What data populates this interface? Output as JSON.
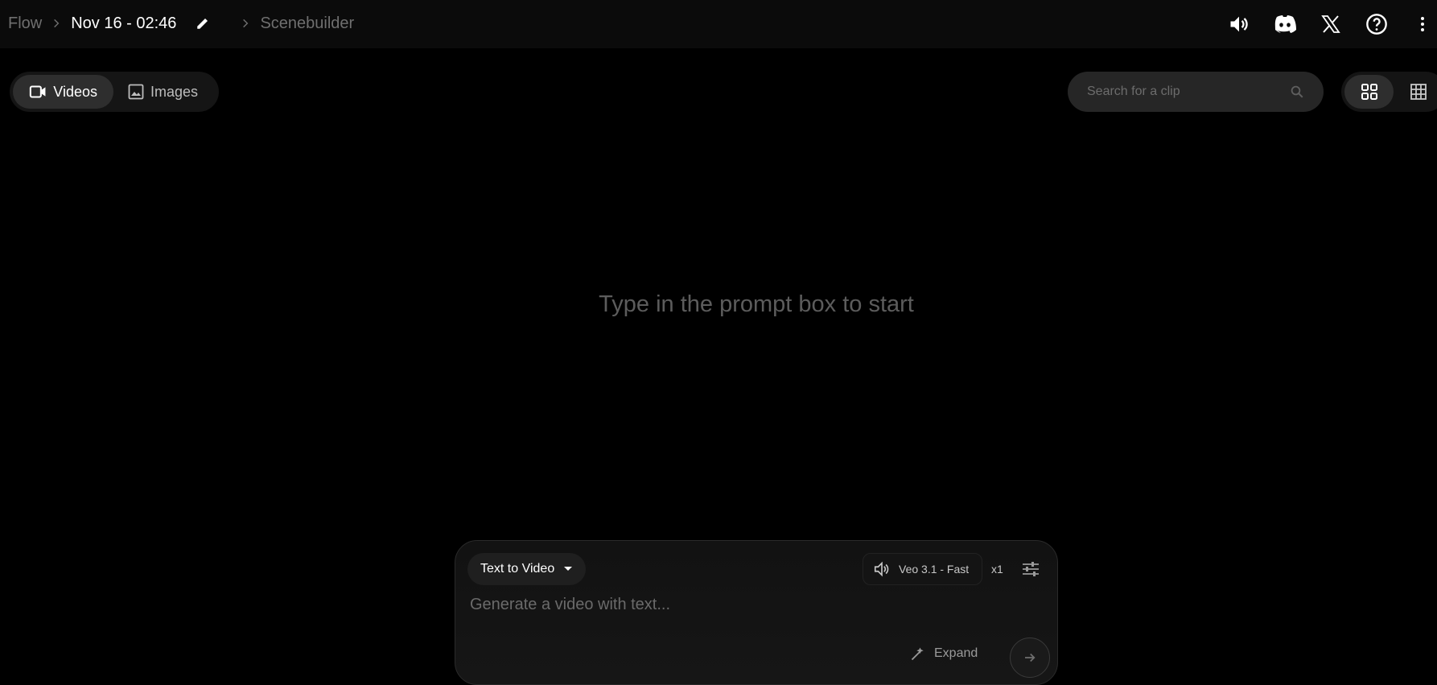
{
  "breadcrumb": {
    "root": "Flow",
    "project_title": "Nov 16 - 02:46",
    "section": "Scenebuilder"
  },
  "top_icons": [
    "volume-icon",
    "discord-icon",
    "x-icon",
    "help-icon",
    "more-vert-icon"
  ],
  "media_tabs": {
    "videos": "Videos",
    "images": "Images",
    "active": "videos"
  },
  "search": {
    "placeholder": "Search for a clip"
  },
  "view_toggle": {
    "active": "grid-large"
  },
  "main": {
    "empty_message": "Type in the prompt box to start"
  },
  "prompt_box": {
    "mode_label": "Text to Video",
    "model_label": "Veo 3.1 - Fast",
    "count_label": "x1",
    "input_placeholder": "Generate a video with text...",
    "expand_label": "Expand"
  },
  "colors": {
    "background": "#000000",
    "topbar": "#0b0b0b",
    "pill_active": "#2e2e2e",
    "muted_text": "#6f6f6f"
  }
}
